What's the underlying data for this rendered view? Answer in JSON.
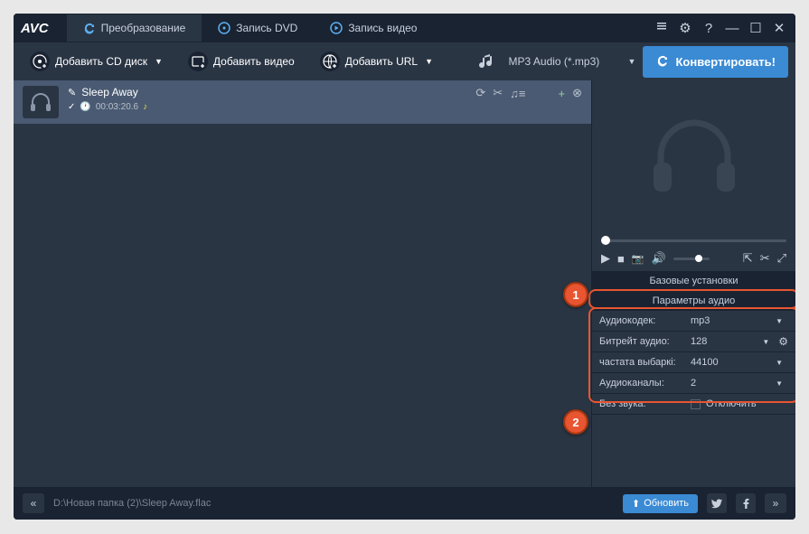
{
  "logo": "AVC",
  "tabs": {
    "convert": "Преобразование",
    "dvd": "Запись DVD",
    "video": "Запись видео"
  },
  "toolbar": {
    "add_cd": "Добавить CD диск",
    "add_video": "Добавить видео",
    "add_url": "Добавить URL",
    "format": "MP3 Audio (*.mp3)",
    "convert": "Конвертировать!"
  },
  "file": {
    "name": "Sleep Away",
    "duration": "00:03:20.6"
  },
  "settings": {
    "base_title": "Базовые установки",
    "audio_title": "Параметры аудио",
    "codec_label": "Аудиокодек:",
    "codec_value": "mp3",
    "bitrate_label": "Битрейт аудио:",
    "bitrate_value": "128",
    "sample_label": "частата выбаркі:",
    "sample_value": "44100",
    "channels_label": "Аудиоканалы:",
    "channels_value": "2",
    "mute_label": "Без звука:",
    "mute_value": "Отключить"
  },
  "badges": {
    "one": "1",
    "two": "2"
  },
  "status": {
    "path": "D:\\Новая папка (2)\\Sleep Away.flac",
    "update": "Обновить"
  }
}
